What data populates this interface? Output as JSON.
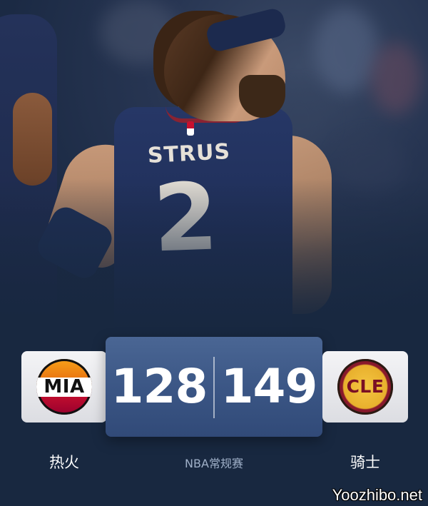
{
  "hero": {
    "jersey_name": "STRUS",
    "jersey_number": "2"
  },
  "match": {
    "home": {
      "abbr": "MIA",
      "name": "热火",
      "score": "128",
      "logo_colors": [
        "#f7a11a",
        "#c8102e",
        "#98002e"
      ]
    },
    "away": {
      "abbr": "CLE",
      "name": "骑士",
      "score": "149",
      "logo_colors": [
        "#f4c542",
        "#7a0f24"
      ]
    },
    "league": "NBA常规赛"
  },
  "watermark": "Yoozhibo.net",
  "colors": {
    "background": "#182840",
    "score_box": "#3a5584",
    "team_box": "#e6e7eb",
    "label_muted": "#9fb0c8"
  }
}
